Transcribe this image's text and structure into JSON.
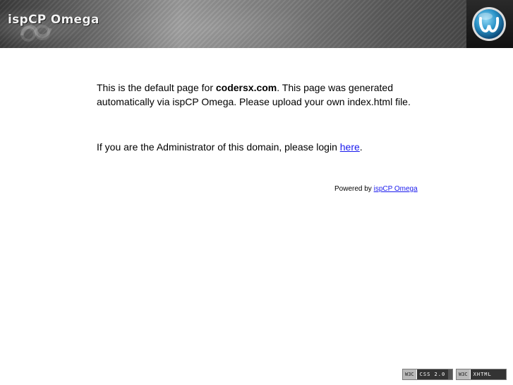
{
  "header": {
    "logo_text": "ispCP Omega"
  },
  "content": {
    "intro_before": "This is the default page for ",
    "domain": "codersx.com",
    "intro_after": ". This page was generated automatically via ispCP Omega. Please upload your own index.html file.",
    "admin_before": "If you are the Administrator of this domain, please login ",
    "admin_link": "here",
    "admin_after": "."
  },
  "footer": {
    "powered_by": "Powered by ",
    "powered_link": "ispCP Omega"
  },
  "badges": {
    "css": {
      "left": "W3C",
      "right": "CSS 2.0"
    },
    "xhtml": {
      "left": "W3C",
      "right": "XHTML 1.0"
    }
  },
  "colors": {
    "link": "#1a1aee"
  }
}
